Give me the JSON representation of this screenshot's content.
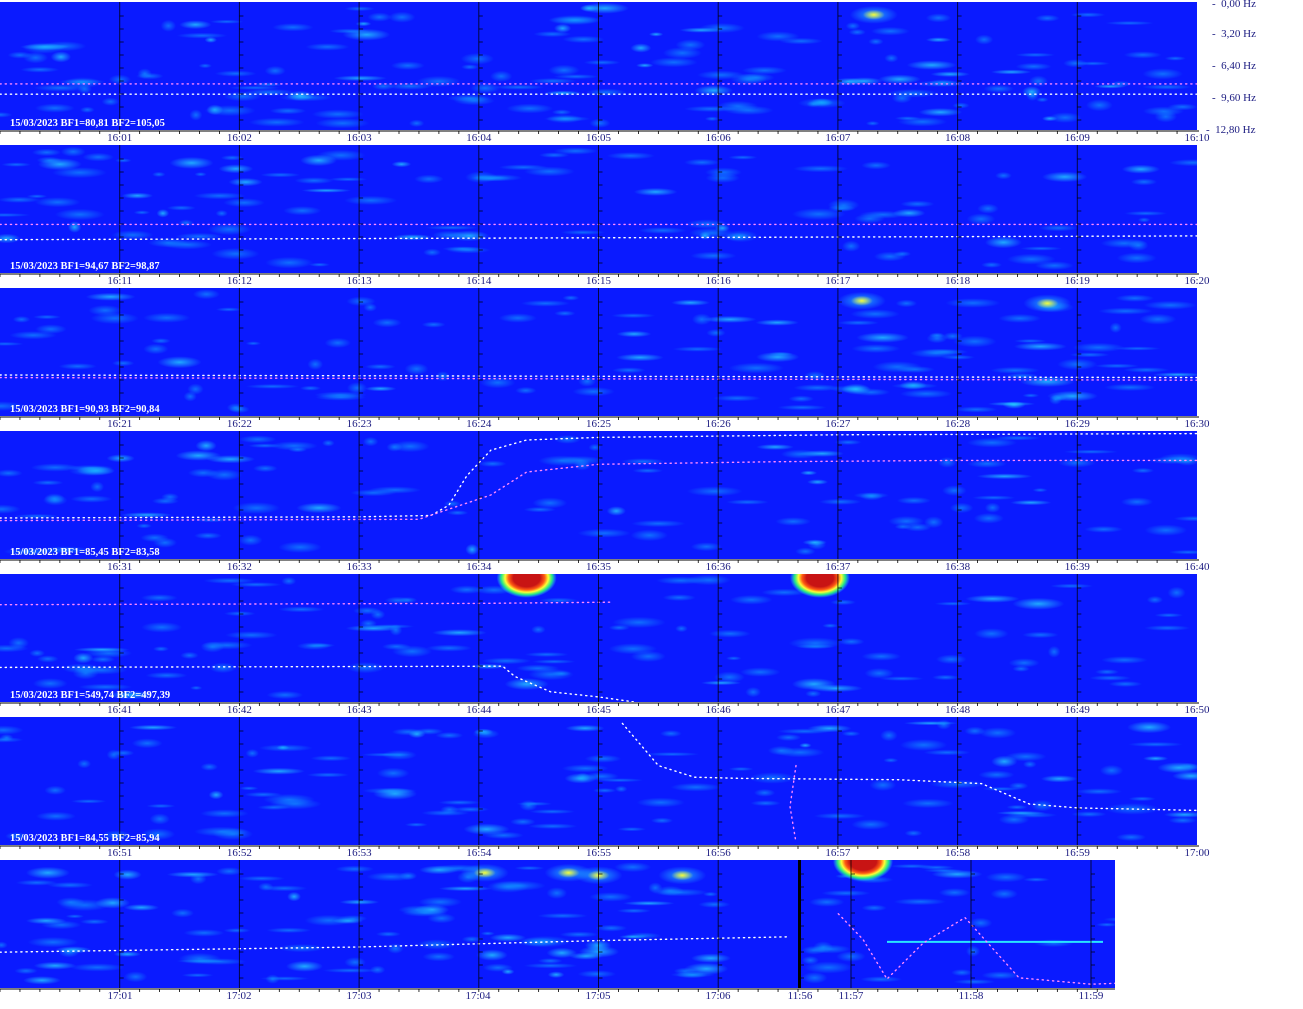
{
  "frequency_axis": [
    "0,00 Hz",
    "3,20 Hz",
    "6,40 Hz",
    "9,60 Hz",
    "12,80 Hz"
  ],
  "colors": {
    "background": "#0a1aff",
    "low": "#0a1aff",
    "mid": "#14b4ff",
    "high": "#ffff33",
    "peak": "#c81414",
    "trace": "#ffffff",
    "trace_alt": "#ff88ff",
    "time_label": "#1a1a80"
  },
  "chart_data": {
    "type": "heatmap",
    "title": "",
    "y_ticks": [
      "0,00 Hz",
      "3,20 Hz",
      "6,40 Hz",
      "9,60 Hz",
      "12,80 Hz"
    ],
    "rows": [
      {
        "stamp": "15/03/2023 BF1=80,81 BF2=105,05",
        "time_ticks": [
          "16:01",
          "16:02",
          "16:03",
          "16:04",
          "16:05",
          "16:06",
          "16:07",
          "16:08",
          "16:09",
          "16:10"
        ],
        "activity": [
          0.55,
          0.45,
          0.5,
          0.55,
          0.6,
          0.5,
          0.45,
          0.7,
          0.5,
          0.45
        ],
        "hotspots": [
          {
            "t": 7.3,
            "f": 0.1,
            "level": 0.85
          }
        ],
        "trace1": [
          [
            0,
            0.72
          ],
          [
            10,
            0.72
          ]
        ],
        "trace2": [
          [
            0,
            0.64
          ],
          [
            10,
            0.64
          ]
        ]
      },
      {
        "stamp": "15/03/2023 BF1=94,67 BF2=98,87",
        "time_ticks": [
          "16:11",
          "16:12",
          "16:13",
          "16:14",
          "16:15",
          "16:16",
          "16:17",
          "16:18",
          "16:19",
          "16:20"
        ],
        "activity": [
          0.45,
          0.65,
          0.4,
          0.35,
          0.3,
          0.3,
          0.3,
          0.35,
          0.35,
          0.3
        ],
        "hotspots": [
          {
            "t": 1.6,
            "f": 0.14,
            "level": 0.75
          },
          {
            "t": 0.5,
            "f": 0.15,
            "level": 0.65
          }
        ],
        "trace1": [
          [
            0,
            0.74
          ],
          [
            10,
            0.71
          ]
        ],
        "trace2": [
          [
            0,
            0.62
          ],
          [
            10,
            0.62
          ]
        ]
      },
      {
        "stamp": "15/03/2023 BF1=90,93 BF2=90,84",
        "time_ticks": [
          "16:21",
          "16:22",
          "16:23",
          "16:24",
          "16:25",
          "16:26",
          "16:27",
          "16:28",
          "16:29",
          "16:30"
        ],
        "activity": [
          0.35,
          0.35,
          0.3,
          0.3,
          0.3,
          0.3,
          0.35,
          0.65,
          0.6,
          0.45
        ],
        "hotspots": [
          {
            "t": 7.2,
            "f": 0.1,
            "level": 0.9
          },
          {
            "t": 8.75,
            "f": 0.12,
            "level": 0.95
          },
          {
            "t": 1.5,
            "f": 0.58,
            "level": 0.7
          }
        ],
        "trace1": [
          [
            0,
            0.68
          ],
          [
            10,
            0.7
          ]
        ],
        "trace2": [
          [
            0,
            0.7
          ],
          [
            10,
            0.72
          ]
        ]
      },
      {
        "stamp": "15/03/2023 BF1=85,45 BF2=83,58",
        "time_ticks": [
          "16:31",
          "16:32",
          "16:33",
          "16:34",
          "16:35",
          "16:36",
          "16:37",
          "16:38",
          "16:39",
          "16:40"
        ],
        "activity": [
          0.5,
          0.5,
          0.35,
          0.3,
          0.3,
          0.3,
          0.35,
          0.4,
          0.4,
          0.35
        ],
        "hotspots": [],
        "trace1": [
          [
            0,
            0.68
          ],
          [
            3,
            0.67
          ],
          [
            3.6,
            0.66
          ],
          [
            3.75,
            0.58
          ],
          [
            3.9,
            0.35
          ],
          [
            4.1,
            0.15
          ],
          [
            4.4,
            0.07
          ],
          [
            5,
            0.05
          ],
          [
            7,
            0.03
          ],
          [
            10,
            0.02
          ]
        ],
        "trace2": [
          [
            0,
            0.7
          ],
          [
            3.5,
            0.69
          ],
          [
            4.1,
            0.5
          ],
          [
            4.4,
            0.32
          ],
          [
            5,
            0.26
          ],
          [
            6.5,
            0.24
          ],
          [
            8,
            0.23
          ],
          [
            10,
            0.23
          ]
        ]
      },
      {
        "stamp": "15/03/2023 BF1=549,74 BF2=497,39",
        "time_ticks": [
          "16:41",
          "16:42",
          "16:43",
          "16:44",
          "16:45",
          "16:46",
          "16:47",
          "16:48",
          "16:49",
          "16:50"
        ],
        "activity": [
          0.45,
          0.4,
          0.3,
          0.5,
          0.35,
          0.3,
          0.5,
          0.3,
          0.3,
          0.3
        ],
        "hotspots": [
          {
            "t": 4.4,
            "f": 0.03,
            "level": 1.0
          },
          {
            "t": 6.85,
            "f": 0.03,
            "level": 1.0
          },
          {
            "t": 4.4,
            "f": 0.86,
            "level": 0.65
          },
          {
            "t": 6.8,
            "f": 0.86,
            "level": 0.65
          }
        ],
        "trace1": [
          [
            0,
            0.73
          ],
          [
            4.2,
            0.72
          ],
          [
            4.3,
            0.8
          ],
          [
            4.6,
            0.92
          ],
          [
            5,
            0.96
          ],
          [
            5.3,
            1.0
          ]
        ],
        "trace2": [
          [
            0,
            0.24
          ],
          [
            4,
            0.23
          ],
          [
            5.1,
            0.22
          ]
        ]
      },
      {
        "stamp": "15/03/2023 BF1=84,55 BF2=85,94",
        "time_ticks": [
          "16:51",
          "16:52",
          "16:53",
          "16:54",
          "16:55",
          "16:56",
          "16:57",
          "16:58",
          "16:59",
          "17:00"
        ],
        "activity": [
          0.35,
          0.4,
          0.4,
          0.45,
          0.45,
          0.4,
          0.35,
          0.45,
          0.5,
          0.45
        ],
        "hotspots": [
          {
            "t": 9.6,
            "f": 0.08,
            "level": 0.75
          },
          {
            "t": 3.3,
            "f": 0.6,
            "level": 0.6
          }
        ],
        "trace1": [
          [
            5.2,
            0.05
          ],
          [
            5.5,
            0.38
          ],
          [
            5.8,
            0.47
          ],
          [
            6.2,
            0.48
          ],
          [
            7.5,
            0.49
          ],
          [
            8.2,
            0.52
          ],
          [
            8.6,
            0.68
          ],
          [
            9,
            0.71
          ],
          [
            10,
            0.73
          ]
        ],
        "trace2": [
          [
            6.65,
            0.38
          ],
          [
            6.6,
            0.7
          ],
          [
            6.65,
            0.98
          ]
        ]
      },
      {
        "stamp": "",
        "time_ticks": [
          "17:01",
          "17:02",
          "17:03",
          "17:04",
          "17:05",
          "17:06",
          "11:56",
          "11:57",
          "11:58",
          "11:59"
        ],
        "activity": [
          0.6,
          0.5,
          0.55,
          0.65,
          0.7,
          0.6,
          0.35,
          0.35,
          0.3,
          0.3
        ],
        "hotspots": [
          {
            "t": 4.05,
            "f": 0.1,
            "level": 0.9
          },
          {
            "t": 5.0,
            "f": 0.12,
            "level": 0.95
          },
          {
            "t": 4.75,
            "f": 0.1,
            "level": 0.9
          },
          {
            "t": 5.7,
            "f": 0.12,
            "level": 0.85
          },
          {
            "t": 0.4,
            "f": 0.1,
            "level": 0.8
          },
          {
            "t": 5.9,
            "f": 0.85,
            "level": 0.7
          },
          {
            "t": 7.1,
            "f": 0.01,
            "level": 1.0
          }
        ],
        "trace1": [
          [
            0,
            0.72
          ],
          [
            3,
            0.68
          ],
          [
            5,
            0.63
          ],
          [
            6.6,
            0.6
          ]
        ],
        "trace2": [
          [
            6.9,
            0.42
          ],
          [
            7.1,
            0.62
          ],
          [
            7.3,
            0.93
          ],
          [
            7.6,
            0.65
          ],
          [
            7.95,
            0.45
          ],
          [
            8.4,
            0.92
          ],
          [
            9,
            0.97
          ],
          [
            9.3,
            0.96
          ]
        ],
        "band": {
          "from": 7.3,
          "to": 9.1,
          "f": 0.64
        }
      }
    ]
  }
}
